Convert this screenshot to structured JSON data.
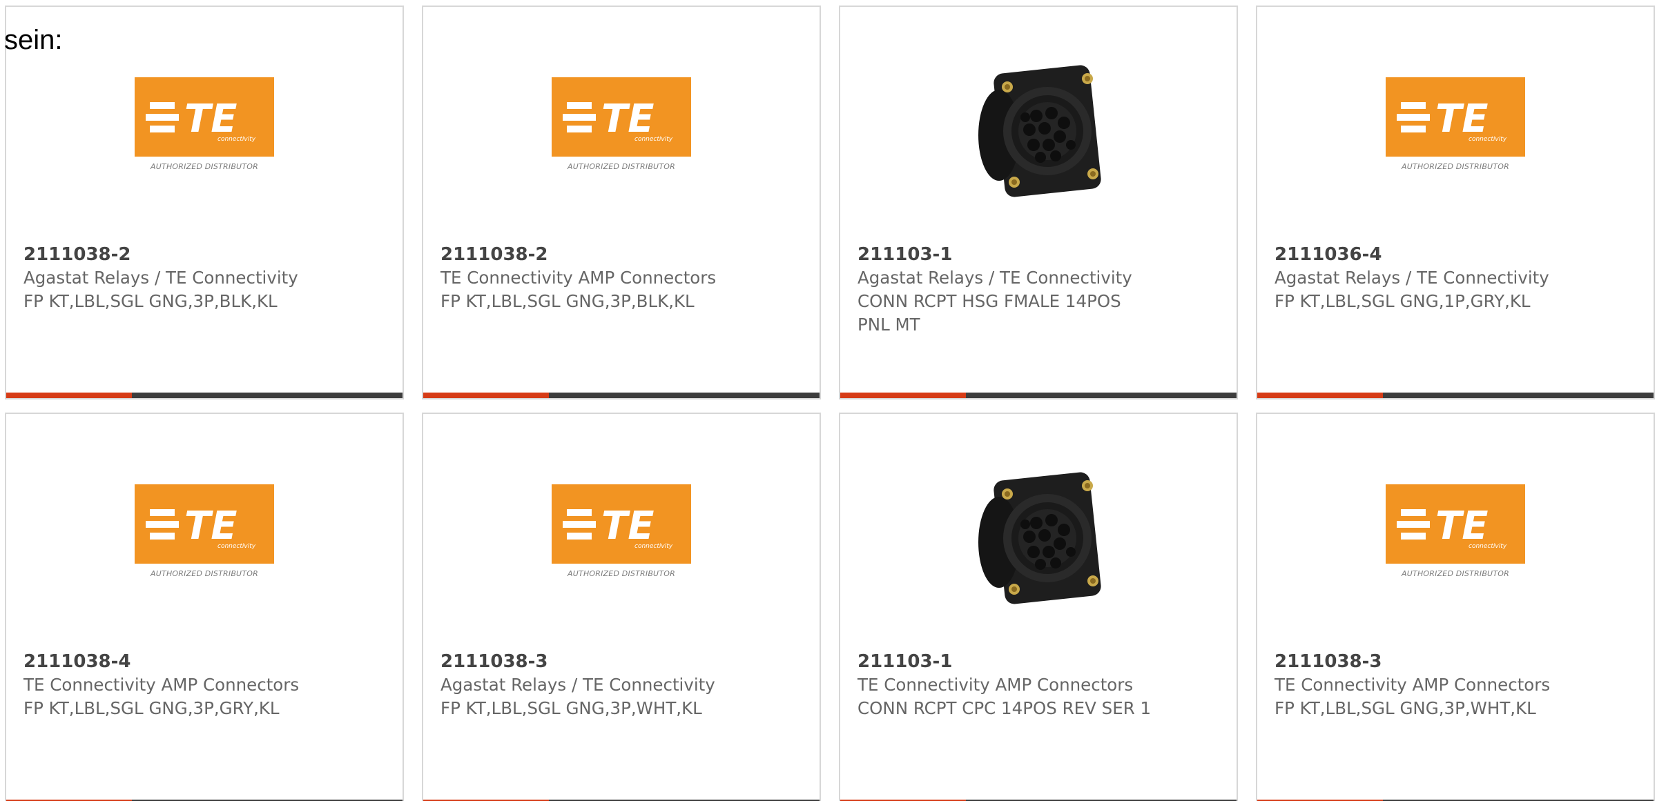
{
  "intro_text": "sein:",
  "logo": {
    "brand_text": "TE",
    "brand_sub": "connectivity",
    "tagline": "AUTHORIZED DISTRIBUTOR"
  },
  "products": [
    {
      "part": "2111038-2",
      "maker": "Agastat Relays / TE Connectivity",
      "desc": "FP KT,LBL,SGL GNG,3P,BLK,KL",
      "image": "te-logo"
    },
    {
      "part": "2111038-2",
      "maker": "TE Connectivity AMP Connectors",
      "desc": "FP KT,LBL,SGL GNG,3P,BLK,KL",
      "image": "te-logo"
    },
    {
      "part": "211103-1",
      "maker": "Agastat Relays / TE Connectivity",
      "desc": "CONN RCPT HSG FMALE 14POS PNL MT",
      "image": "connector"
    },
    {
      "part": "2111036-4",
      "maker": "Agastat Relays / TE Connectivity",
      "desc": "FP KT,LBL,SGL GNG,1P,GRY,KL",
      "image": "te-logo"
    },
    {
      "part": "2111038-4",
      "maker": "TE Connectivity AMP Connectors",
      "desc": "FP KT,LBL,SGL GNG,3P,GRY,KL",
      "image": "te-logo"
    },
    {
      "part": "2111038-3",
      "maker": "Agastat Relays / TE Connectivity",
      "desc": "FP KT,LBL,SGL GNG,3P,WHT,KL",
      "image": "te-logo"
    },
    {
      "part": "211103-1",
      "maker": "TE Connectivity AMP Connectors",
      "desc": "CONN RCPT CPC 14POS REV SER 1",
      "image": "connector"
    },
    {
      "part": "2111038-3",
      "maker": "TE Connectivity AMP Connectors",
      "desc": "FP KT,LBL,SGL GNG,3P,WHT,KL",
      "image": "te-logo"
    }
  ],
  "colors": {
    "logo_orange": "#f29422",
    "bar_accent": "#d63c17",
    "bar_dark": "#3d3d3d",
    "card_border": "#d7d7d7"
  }
}
